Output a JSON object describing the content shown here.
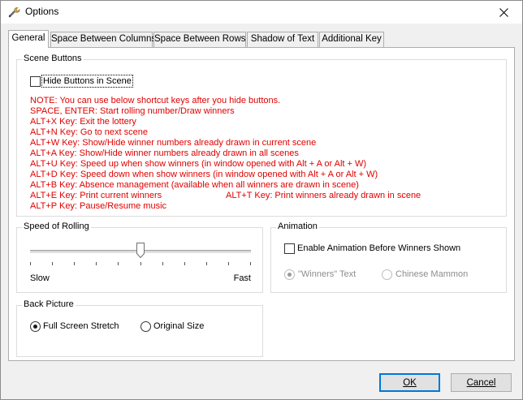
{
  "window": {
    "title": "Options",
    "close_symbol": "✕"
  },
  "tabs": [
    {
      "label": "General",
      "active": true
    },
    {
      "label": "Space Between Columns",
      "active": false
    },
    {
      "label": "Space Between Rows",
      "active": false
    },
    {
      "label": "Shadow of Text",
      "active": false
    },
    {
      "label": "Additional Key",
      "active": false
    }
  ],
  "scene_buttons": {
    "title": "Scene Buttons",
    "hide_label": "Hide Buttons in Scene",
    "hide_checked": false,
    "notes": [
      "NOTE: You can use below shortcut keys after you hide buttons.",
      "SPACE, ENTER: Start rolling number/Draw winners",
      "ALT+X Key: Exit the lottery",
      "ALT+N Key: Go to next scene",
      "ALT+W Key: Show/Hide winner numbers already drawn in current scene",
      "ALT+A Key: Show/Hide winner numbers already drawn in all scenes",
      "ALT+U Key: Speed up when show winners (in window opened with Alt + A or Alt + W)",
      "ALT+D Key: Speed down when show winners (in window opened with Alt + A or Alt + W)",
      "ALT+B Key: Absence management (available when all winners are drawn in scene)",
      "ALT+E Key: Print current winners",
      "ALT+P Key: Pause/Resume music"
    ],
    "note_extra": "ALT+T Key: Print winners already drawn in scene"
  },
  "speed": {
    "title": "Speed of Rolling",
    "min_label": "Slow",
    "max_label": "Fast",
    "value_fraction": 0.5
  },
  "animation": {
    "title": "Animation",
    "enable_label": "Enable Animation Before Winners Shown",
    "enable_checked": false,
    "option1": "\"Winners\" Text",
    "option2": "Chinese Mammon",
    "selected": "option1"
  },
  "back_picture": {
    "title": "Back Picture",
    "option1": "Full Screen Stretch",
    "option2": "Original Size",
    "selected": "option1"
  },
  "buttons": {
    "ok": "OK",
    "cancel": "Cancel"
  },
  "colors": {
    "note_red": "#e00000",
    "accent": "#0078d7"
  }
}
